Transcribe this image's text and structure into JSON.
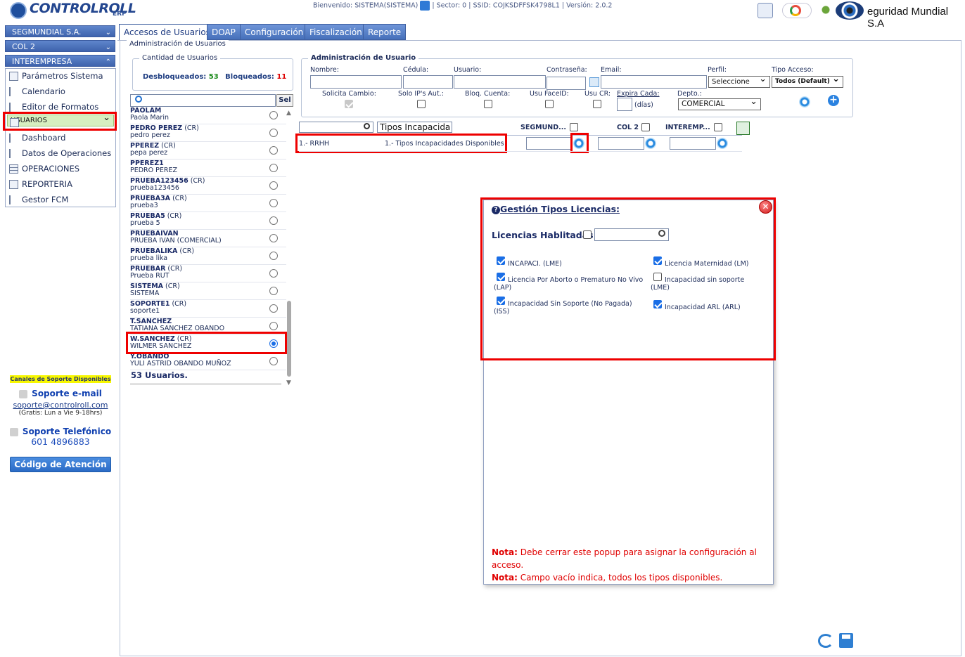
{
  "header": {
    "brand": "CONTROLROLL",
    "brand_sub": "ERP",
    "welcome_prefix": "Bienvenido: SISTEMA(SISTEMA)",
    "info": "| Sector: 0 | SSID: COJKSDFFSK4798L1 | Versión: 2.0.2",
    "company": "eguridad Mundial S.A"
  },
  "sidebar": {
    "accordions": [
      "SEGMUNDIAL S.A.",
      "COL 2",
      "INTEREMPRESA"
    ],
    "items": [
      {
        "label": "Parámetros Sistema",
        "icon": "settings-tree-icon"
      },
      {
        "label": "Calendario",
        "icon": "tree-icon"
      },
      {
        "label": "Editor de Formatos",
        "icon": "tree-icon"
      },
      {
        "label": "USUARIOS",
        "icon": "window-icon",
        "selected": true
      },
      {
        "label": "Dashboard",
        "icon": "tree-icon"
      },
      {
        "label": "Datos de Operaciones",
        "icon": "tree-icon"
      },
      {
        "label": "OPERACIONES",
        "icon": "table-icon"
      },
      {
        "label": "REPORTERIA",
        "icon": "chart-icon"
      },
      {
        "label": "Gestor FCM",
        "icon": "tree-icon"
      }
    ],
    "support": {
      "title": "Canales de Soporte Disponibles",
      "email_title": "Soporte e-mail",
      "email": "soporte@controlroll.com",
      "email_hours": "(Gratis: Lun a Vie 9-18hrs)",
      "phone_title": "Soporte Telefónico",
      "phone": "601 4896883",
      "attention_button": "Código de Atención"
    }
  },
  "tabs": [
    "Accesos de Usuarios",
    "DOAP",
    "Configuración",
    "Fiscalización",
    "Reporte"
  ],
  "section_title": "Administración de Usuarios",
  "users_count": {
    "legend": "Cantidad de Usuarios",
    "unlocked_label": "Desbloqueados:",
    "unlocked": "53",
    "locked_label": "Bloqueados:",
    "locked": "11",
    "sel_button": "Sel"
  },
  "users": [
    {
      "login": "PAOLAM",
      "suffix": "",
      "name": "Paola Marin"
    },
    {
      "login": "PEDRO PEREZ",
      "suffix": "(CR)",
      "name": "pedro perez"
    },
    {
      "login": "PPEREZ",
      "suffix": "(CR)",
      "name": "pepa perez"
    },
    {
      "login": "PPEREZ1",
      "suffix": "",
      "name": "PEDRO PEREZ"
    },
    {
      "login": "PRUEBA123456",
      "suffix": "(CR)",
      "name": "prueba123456"
    },
    {
      "login": "PRUEBA3A",
      "suffix": "(CR)",
      "name": "prueba3"
    },
    {
      "login": "PRUEBA5",
      "suffix": "(CR)",
      "name": "prueba 5"
    },
    {
      "login": "PRUEBAIVAN",
      "suffix": "",
      "name": "PRUEBA IVAN (COMERCIAL)"
    },
    {
      "login": "PRUEBALIKA",
      "suffix": "(CR)",
      "name": "prueba lika"
    },
    {
      "login": "PRUEBAR",
      "suffix": "(CR)",
      "name": "Prueba RUT"
    },
    {
      "login": "SISTEMA",
      "suffix": "(CR)",
      "name": "SISTEMA"
    },
    {
      "login": "SOPORTE1",
      "suffix": "(CR)",
      "name": "soporte1"
    },
    {
      "login": "T.SANCHEZ",
      "suffix": "",
      "name": "TATIANA SANCHEZ OBANDO"
    },
    {
      "login": "W.SANCHEZ",
      "suffix": "(CR)",
      "name": "WILMER SANCHEZ",
      "selected": true
    },
    {
      "login": "Y.OBANDO",
      "suffix": "",
      "name": "YULI ASTRID OBANDO MUÑOZ"
    }
  ],
  "users_total": "53 Usuarios.",
  "admin": {
    "legend": "Administración de Usuario",
    "labels": {
      "nombre": "Nombre:",
      "cedula": "Cédula:",
      "usuario": "Usuario:",
      "contrasena": "Contraseña:",
      "email": "Email:",
      "perfil": "Perfil:",
      "tipo_acceso": "Tipo Acceso:",
      "solicita": "Solicita Cambio:",
      "solo_ip": "Solo IP's Aut.:",
      "bloq": "Bloq. Cuenta:",
      "faceid": "Usu FaceID:",
      "usucr": "Usu CR:",
      "expira": "Expira Cada:",
      "dias": "(días)",
      "depto": "Depto.:"
    },
    "perfil_value": "Seleccione",
    "tipo_acceso_value": "Todos (Default)",
    "depto_value": "COMERCIAL"
  },
  "grid": {
    "filter_label": "Tipos Incapacida",
    "columns": [
      "SEGMUND...",
      "COL 2",
      "INTEREMP..."
    ],
    "row_area": "1.- RRHH",
    "row_type": "1.- Tipos Incapacidades Disponibles"
  },
  "popup": {
    "title": "Gestión Tipos Licencias:",
    "enabled_label": "Licencias Hablitadas:",
    "options": [
      {
        "label": "INCAPACI. (LME)",
        "checked": true
      },
      {
        "label": "Licencia Maternidad (LM)",
        "checked": true
      },
      {
        "label": "Licencia Por Aborto o Prematuro No Vivo (LAP)",
        "checked": true
      },
      {
        "label": "Incapacidad sin soporte (LME)",
        "checked": false
      },
      {
        "label": "Incapacidad Sin Soporte (No Pagada) (ISS)",
        "checked": true
      },
      {
        "label": "Incapacidad ARL (ARL)",
        "checked": true
      }
    ],
    "note_label": "Nota:",
    "note1": "Debe cerrar este popup para asignar la configuración al acceso.",
    "note2": "Campo vacío indica, todos los tipos disponibles."
  }
}
